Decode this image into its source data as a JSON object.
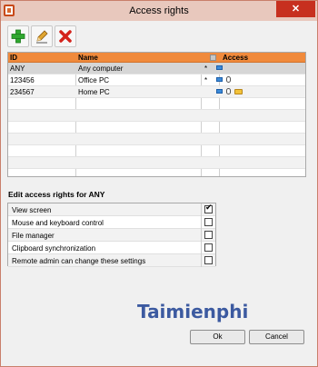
{
  "window": {
    "title": "Access rights",
    "close_glyph": "✕"
  },
  "toolbar": {
    "buttons": [
      {
        "name": "add",
        "icon": "plus-icon",
        "color": "#2fa82f"
      },
      {
        "name": "edit",
        "icon": "pencil-icon",
        "color": "#e0a531"
      },
      {
        "name": "delete",
        "icon": "x-icon",
        "color": "#d4221b"
      }
    ]
  },
  "grid": {
    "columns": {
      "id": "ID",
      "name": "Name",
      "access": "Access"
    },
    "header_color": "#f08a3c",
    "rows": [
      {
        "id": "ANY",
        "name": "Any computer",
        "flag": "*",
        "access_icons": [
          "monitor-icon"
        ]
      },
      {
        "id": "123456",
        "name": "Office PC",
        "flag": "*",
        "access_icons": [
          "monitor-icon",
          "mouse-icon"
        ]
      },
      {
        "id": "234567",
        "name": "Home PC",
        "flag": "",
        "access_icons": [
          "monitor-icon",
          "mouse-icon",
          "folder-icon"
        ]
      }
    ]
  },
  "rights": {
    "title": "Edit access rights for ANY",
    "items": [
      {
        "label": "View screen",
        "checked": true
      },
      {
        "label": "Mouse and keyboard control",
        "checked": false
      },
      {
        "label": "File manager",
        "checked": false
      },
      {
        "label": "Clipboard synchronization",
        "checked": false
      },
      {
        "label": "Remote admin can change these settings",
        "checked": false
      }
    ]
  },
  "watermark": "Taimienphi",
  "footer": {
    "ok_label": "Ok",
    "cancel_label": "Cancel"
  }
}
